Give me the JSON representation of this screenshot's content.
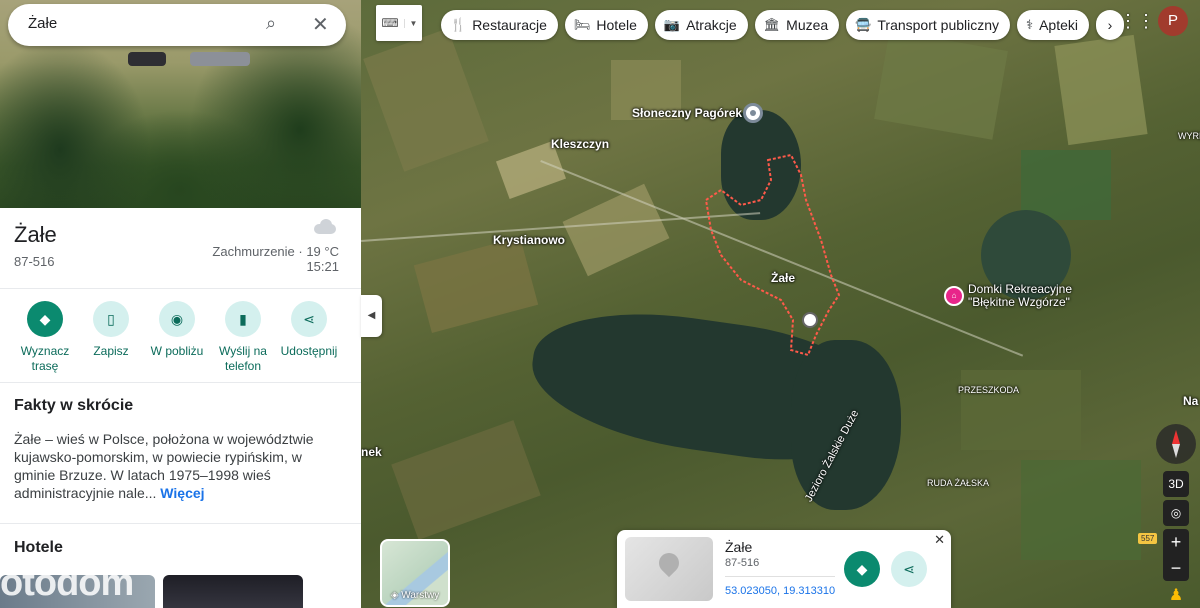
{
  "search": {
    "query": "Żałe"
  },
  "place": {
    "title": "Żałe",
    "zip": "87-516",
    "weather": "Zachmurzenie · 19 °C",
    "time": "15:21"
  },
  "actions": [
    {
      "label": "Wyznacz trasę",
      "icon": "directions-icon"
    },
    {
      "label": "Zapisz",
      "icon": "bookmark-icon"
    },
    {
      "label": "W pobliżu",
      "icon": "nearby-icon"
    },
    {
      "label": "Wyślij na telefon",
      "icon": "send-to-phone-icon"
    },
    {
      "label": "Udostępnij",
      "icon": "share-icon"
    }
  ],
  "facts": {
    "heading": "Fakty w skrócie",
    "text": "Żałe – wieś w Polsce, położona w województwie kujawsko-pomorskim, w powiecie rypińskim, w gminie Brzuze. W latach 1975–1998 wieś administracyjnie nale...",
    "more": "Więcej"
  },
  "hotels_heading": "Hotele",
  "watermark": "otodom",
  "chips": [
    {
      "label": "Restauracje",
      "icon": "fork-knife-icon"
    },
    {
      "label": "Hotele",
      "icon": "bed-icon"
    },
    {
      "label": "Atrakcje",
      "icon": "camera-icon"
    },
    {
      "label": "Muzea",
      "icon": "museum-icon"
    },
    {
      "label": "Transport publiczny",
      "icon": "bus-icon"
    },
    {
      "label": "Apteki",
      "icon": "pharmacy-icon"
    }
  ],
  "map_labels": {
    "sloneczny": "Słoneczny Pagórek",
    "kleszczyn": "Kleszczyn",
    "krystianowo": "Krystianowo",
    "zale": "Żałe",
    "domki": "Domki Rekreacyjne\n\"Błękitne Wzgórze\"",
    "przeszkoda": "PRZESZKODA",
    "ruda": "RUDA ŻAŁSKA",
    "jezioro": "Jezioro Żalskie Duże",
    "wyre": "WYRĘ",
    "na": "Na",
    "nek": "nek",
    "route": "557"
  },
  "avatar_letter": "P",
  "layers_label": "Warstwy",
  "controls": {
    "tilt": "3D"
  },
  "card": {
    "title": "Żałe",
    "zip": "87-516",
    "coords": "53.023050, 19.313310"
  }
}
